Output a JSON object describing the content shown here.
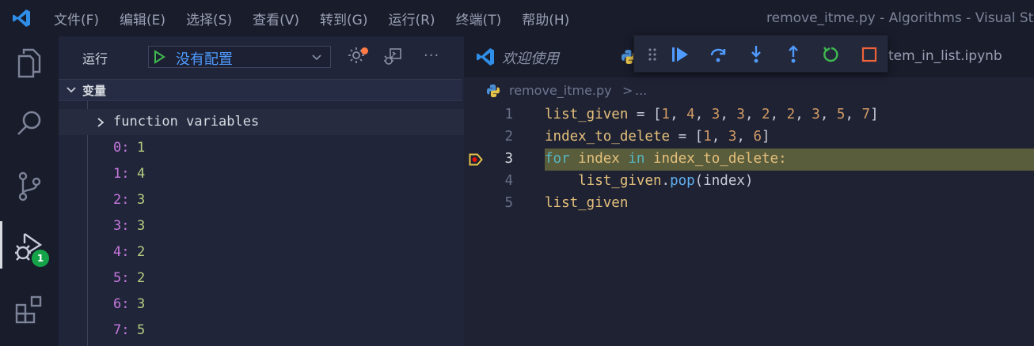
{
  "titlebar": {
    "menu": [
      "文件(F)",
      "编辑(E)",
      "选择(S)",
      "查看(V)",
      "转到(G)",
      "运行(R)",
      "终端(T)",
      "帮助(H)"
    ],
    "window_title": "remove_itme.py - Algorithms - Visual Studio Code"
  },
  "activity_bar": {
    "items": [
      "explorer-icon",
      "search-icon",
      "source-control-icon",
      "run-debug-icon",
      "extensions-icon"
    ],
    "debug_badge": "1"
  },
  "run_panel": {
    "title": "运行",
    "config_value": "没有配置"
  },
  "variables": {
    "section_title": "变量",
    "group_label": "function variables",
    "items": [
      {
        "key": "0:",
        "value": "1"
      },
      {
        "key": "1:",
        "value": "4"
      },
      {
        "key": "2:",
        "value": "3"
      },
      {
        "key": "3:",
        "value": "3"
      },
      {
        "key": "4:",
        "value": "2"
      },
      {
        "key": "5:",
        "value": "2"
      },
      {
        "key": "6:",
        "value": "3"
      },
      {
        "key": "7:",
        "value": "5"
      }
    ]
  },
  "editor": {
    "tabs": [
      {
        "label": "欢迎使用"
      },
      {
        "label": "tem_in_list.ipynb"
      }
    ],
    "breadcrumb": {
      "file": "remove_itme.py",
      "separator": ">",
      "more": "..."
    },
    "lines": [
      {
        "num": "1",
        "text": "list_given = [1, 4, 3, 3, 2, 2, 3, 5, 7]"
      },
      {
        "num": "2",
        "text": "index_to_delete = [1, 3, 6]"
      },
      {
        "num": "3",
        "text": "for index in index_to_delete:"
      },
      {
        "num": "4",
        "text": "    list_given.pop(index)"
      },
      {
        "num": "5",
        "text": "list_given"
      }
    ],
    "current_line": "3"
  },
  "colors": {
    "accent": "#4f9bff",
    "current_line_bg": "#5a5d3c",
    "badge": "#15a34a",
    "debug_green": "#3fb950"
  }
}
